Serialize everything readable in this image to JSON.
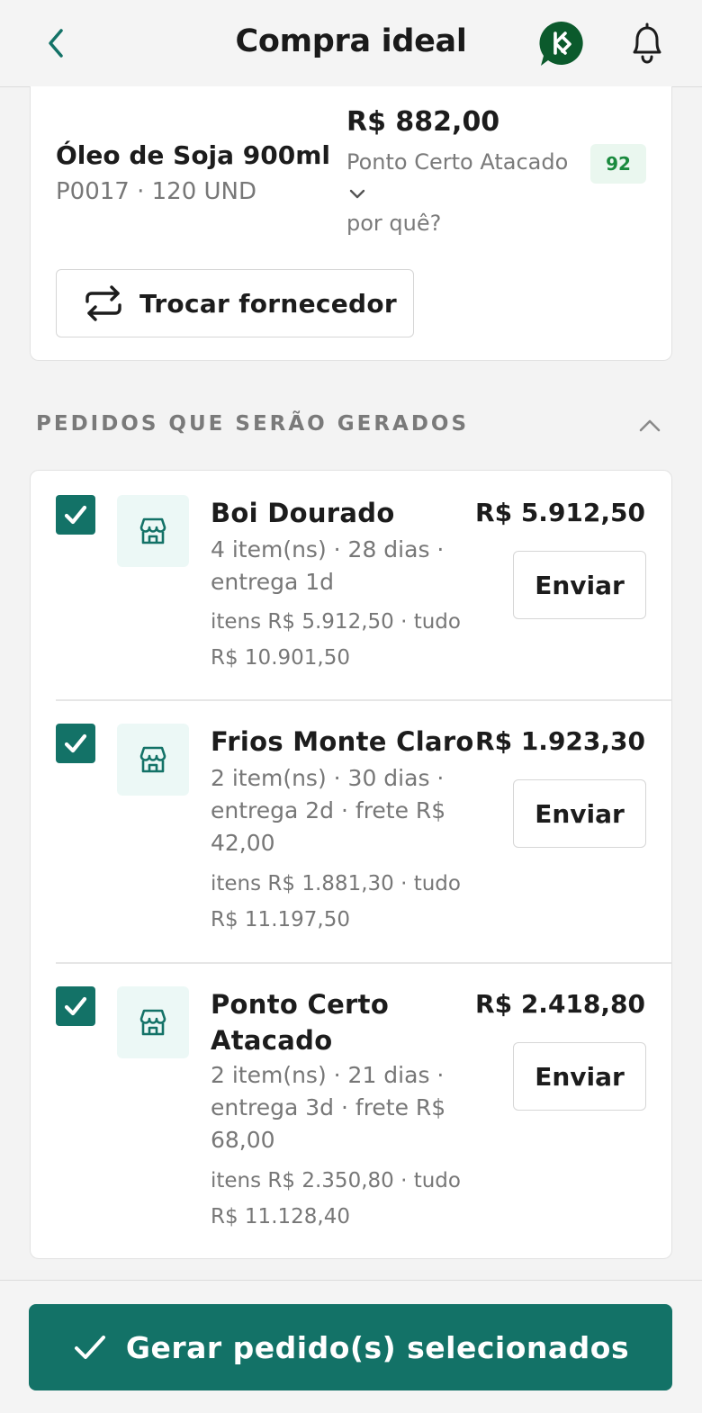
{
  "header": {
    "title": "Compra ideal",
    "back_icon": "chevron-left-icon",
    "brand_icon": "brand-logo-icon",
    "bell_icon": "bell-icon"
  },
  "product": {
    "name": "Óleo de Soja 900ml",
    "code_qty": "P0017 · 120 UND",
    "price": "R$ 882,00",
    "supplier": "Ponto Certo Atacado",
    "score": "92",
    "why_label": "por quê?",
    "swap_label": "Trocar fornecedor"
  },
  "orders_section": {
    "title": "PEDIDOS QUE SERÃO GERADOS",
    "orders": [
      {
        "supplier": "Boi Dourado",
        "meta": "4 item(ns) · 28 dias · entrega 1d",
        "totals": "itens R$ 5.912,50 · tudo R$ 10.901,50",
        "price": "R$ 5.912,50",
        "send_label": "Enviar",
        "checked": true
      },
      {
        "supplier": "Frios Monte Claro",
        "meta": "2 item(ns) · 30 dias · entrega 2d · frete R$ 42,00",
        "totals": "itens R$ 1.881,30 · tudo R$ 11.197,50",
        "price": "R$ 1.923,30",
        "send_label": "Enviar",
        "checked": true
      },
      {
        "supplier": "Ponto Certo Atacado",
        "meta": "2 item(ns) · 21 dias · entrega 3d · frete R$ 68,00",
        "totals": "itens R$ 2.350,80 · tudo R$ 11.128,40",
        "price": "R$ 2.418,80",
        "send_label": "Enviar",
        "checked": true
      }
    ]
  },
  "footer": {
    "generate_label": "Gerar pedido(s) selecionados"
  },
  "colors": {
    "primary": "#137267",
    "brand_dark": "#0b5a2c",
    "score_bg": "#eaf7ef",
    "score_text": "#1a8a3e",
    "store_bg": "#ecf8f6"
  }
}
